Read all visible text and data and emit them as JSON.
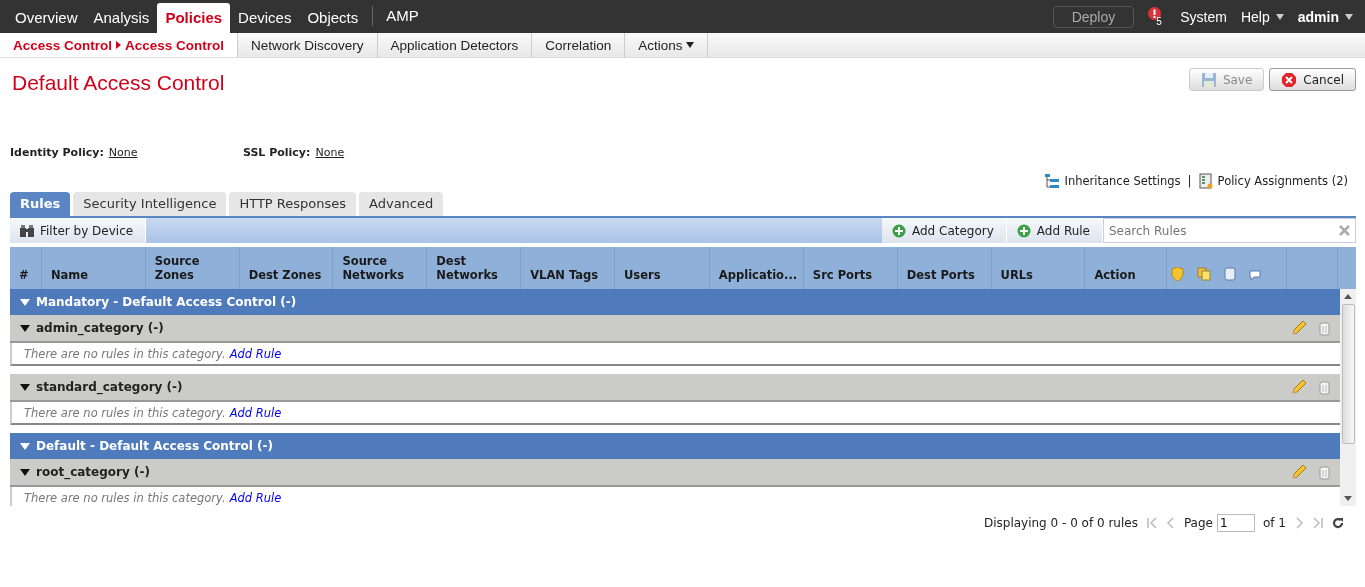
{
  "top_nav": {
    "items": [
      {
        "label": "Overview",
        "selected": false,
        "divider_before": false
      },
      {
        "label": "Analysis",
        "selected": false,
        "divider_before": false
      },
      {
        "label": "Policies",
        "selected": true,
        "divider_before": false
      },
      {
        "label": "Devices",
        "selected": false,
        "divider_before": false
      },
      {
        "label": "Objects",
        "selected": false,
        "divider_before": false
      },
      {
        "label": "AMP",
        "selected": false,
        "divider_before": true
      }
    ],
    "deploy": "Deploy",
    "alert_count": "5",
    "system": "System",
    "help": "Help",
    "user": "admin"
  },
  "sub_nav": [
    {
      "label": "Access Control",
      "crumb": "Access Control",
      "selected": true,
      "dropdown": false
    },
    {
      "label": "Network Discovery",
      "selected": false,
      "dropdown": false
    },
    {
      "label": "Application Detectors",
      "selected": false,
      "dropdown": false
    },
    {
      "label": "Correlation",
      "selected": false,
      "dropdown": false
    },
    {
      "label": "Actions",
      "selected": false,
      "dropdown": true
    }
  ],
  "title": "Default Access Control",
  "buttons": [
    {
      "label": "Save",
      "kind": "save",
      "disabled": true
    },
    {
      "label": "Cancel",
      "kind": "cancel",
      "disabled": false
    }
  ],
  "policies": [
    {
      "label": "Identity Policy:",
      "value": "None"
    },
    {
      "label": "SSL Policy:",
      "value": "None"
    }
  ],
  "links": {
    "inheritance": "Inheritance Settings",
    "separator": "|",
    "assignments": "Policy Assignments (2)"
  },
  "tabs": [
    {
      "label": "Rules",
      "selected": true
    },
    {
      "label": "Security Intelligence",
      "selected": false
    },
    {
      "label": "HTTP Responses",
      "selected": false
    },
    {
      "label": "Advanced",
      "selected": false
    }
  ],
  "toolbar": {
    "filter": "Filter by Device",
    "add_category": "Add Category",
    "add_rule": "Add Rule",
    "search": {
      "placeholder": "Search Rules"
    }
  },
  "table": {
    "columns": [
      "#",
      "Name",
      "Source Zones",
      "Dest Zones",
      "Source Networks",
      "Dest Networks",
      "VLAN Tags",
      "Users",
      "Applicatio...",
      "Src Ports",
      "Dest Ports",
      "URLs",
      "Action"
    ],
    "sections": [
      {
        "title": "Mandatory - Default Access Control (-)",
        "expanded": true,
        "categories": [
          {
            "name": "admin_category (-)",
            "expanded": true,
            "empty_text": "There are no rules in this category.",
            "link": "Add Rule"
          },
          {
            "name": "standard_category (-)",
            "expanded": true,
            "empty_text": "There are no rules in this category.",
            "link": "Add Rule"
          }
        ]
      },
      {
        "title": "Default - Default Access Control (-)",
        "expanded": true,
        "categories": [
          {
            "name": "root_category (-)",
            "expanded": true,
            "empty_text": "There are no rules in this category.",
            "link": "Add Rule"
          }
        ]
      }
    ]
  },
  "footer": {
    "displaying": "Displaying 0 - 0 of 0 rules",
    "page_label": "Page",
    "page": "1",
    "of": "of 1"
  }
}
